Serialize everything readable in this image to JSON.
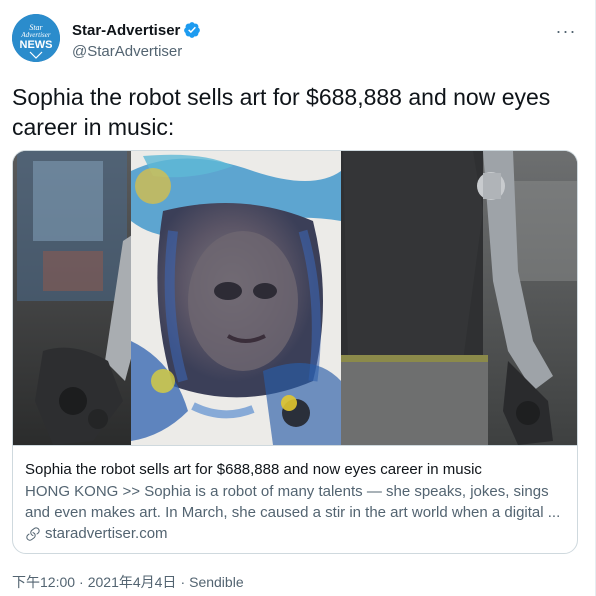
{
  "author": {
    "display_name": "Star-Advertiser",
    "handle": "@StarAdvertiser",
    "verified": true,
    "avatar_logo_text": [
      "Star",
      "Advertiser",
      "NEWS"
    ]
  },
  "more_menu": {
    "label": "···"
  },
  "tweet": {
    "text": "Sophia the robot sells art for $688,888 and now eyes career in music:"
  },
  "card": {
    "image_alt": "Robot Sophia with a colorful abstract self-portrait painting",
    "title": "Sophia the robot sells art for $688,888 and now eyes career in music",
    "description": "HONG KONG >> Sophia is a robot of many talents — she speaks, jokes, sings and even makes art. In March, she caused a stir in the art world when a digital ...",
    "domain": "staradvertiser.com"
  },
  "meta": {
    "time": "下午12:00",
    "separator": "·",
    "date": "2021年4月4日",
    "source": "Sendible"
  },
  "colors": {
    "text_primary": "#0f1419",
    "text_secondary": "#536471",
    "verified_blue": "#1d9bf0",
    "border": "#cfd9de"
  },
  "icons": {
    "verified": "verified-badge-icon",
    "more": "more-horizontal-icon",
    "link": "link-icon"
  }
}
